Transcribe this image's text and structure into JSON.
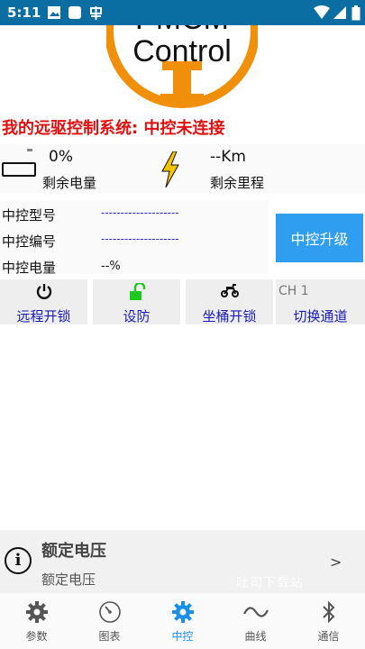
{
  "status_bar": {
    "time": "5:11"
  },
  "logo": {
    "text_top": "PMCM",
    "text_main": "Control"
  },
  "header": {
    "title": "我的远驱控制系统: 中控未连接"
  },
  "stats": {
    "battery_percent": "0%",
    "battery_label": "剩余电量",
    "range_value": "--Km",
    "range_label": "剩余里程"
  },
  "controller": {
    "model_label": "中控型号",
    "model_value": "--------------------",
    "serial_label": "中控编号",
    "serial_value": "--------------------",
    "power_label": "中控电量",
    "power_value": "--%",
    "upgrade_label": "中控升级"
  },
  "actions": [
    {
      "label": "远程开锁",
      "icon": "power-icon"
    },
    {
      "label": "设防",
      "icon": "unlock-icon"
    },
    {
      "label": "坐桶开锁",
      "icon": "scooter-icon"
    },
    {
      "label": "切换通道",
      "icon": "channel"
    }
  ],
  "channel_label": "CH 1",
  "notice": {
    "title": "额定电压",
    "subtitle": "额定电压",
    "arrow": ">",
    "watermark": "吐司下载站"
  },
  "nav": [
    {
      "label": "参数",
      "icon": "gear-icon"
    },
    {
      "label": "图表",
      "icon": "gauge-icon"
    },
    {
      "label": "中控",
      "icon": "gear-icon"
    },
    {
      "label": "曲线",
      "icon": "wave-icon"
    },
    {
      "label": "通信",
      "icon": "bluetooth-icon"
    }
  ],
  "colors": {
    "accent": "#2f9df0",
    "alert": "#e01010",
    "status_bar": "#0b6ea3",
    "link": "#1a1ab8",
    "active_nav": "#1a8fe8"
  }
}
